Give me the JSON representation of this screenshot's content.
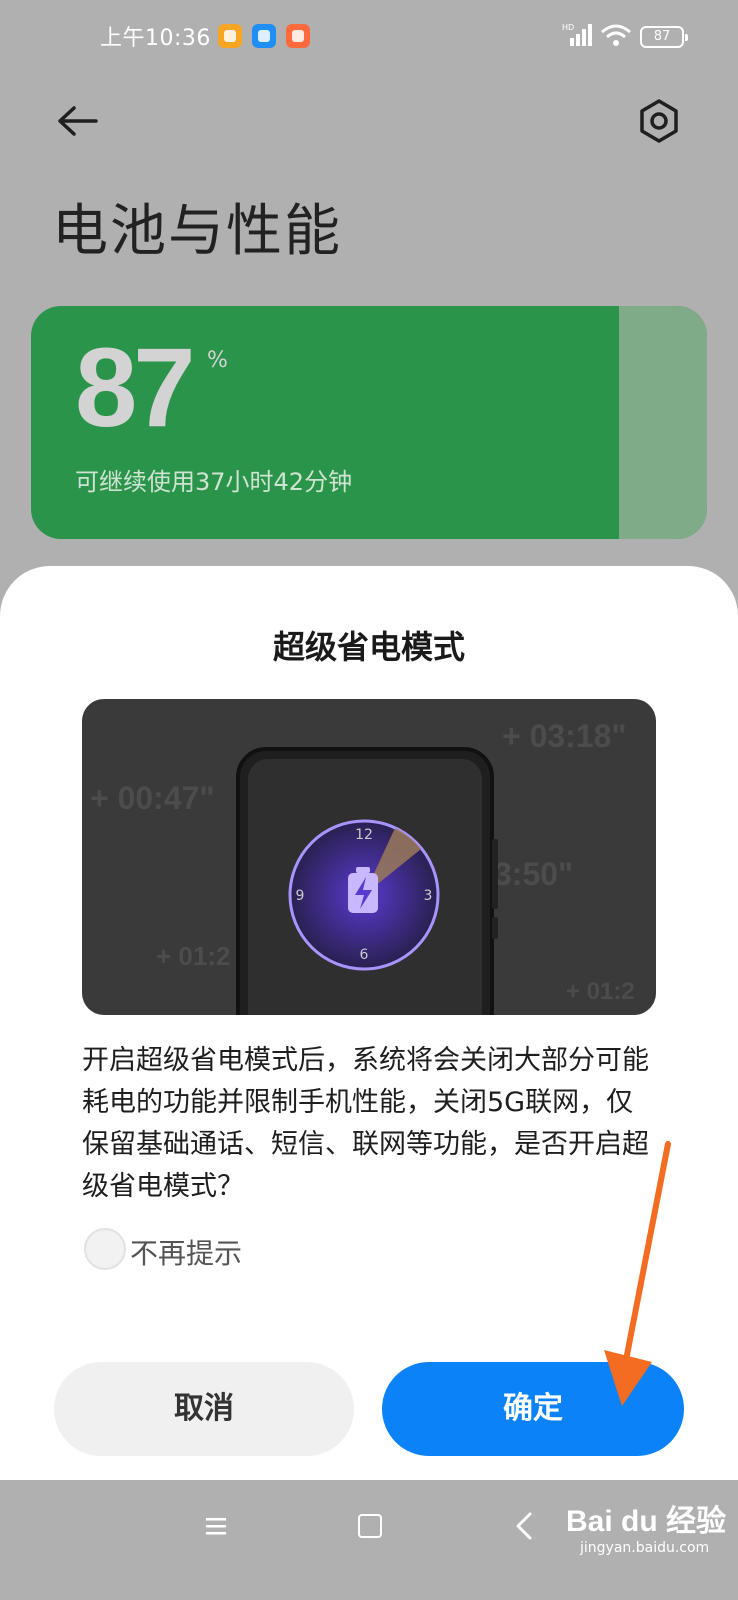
{
  "status_bar": {
    "time": "上午10:36",
    "battery_level": "87",
    "icons": [
      "notification-orange-icon",
      "notification-blue-icon",
      "notification-red-icon",
      "signal-hd-icon",
      "wifi-icon",
      "battery-icon"
    ]
  },
  "header": {
    "title": "电池与性能",
    "back_icon": "back-arrow-icon",
    "settings_icon": "settings-hexagon-icon"
  },
  "battery_card": {
    "percent": "87",
    "unit": "%",
    "remaining": "可继续使用37小时42分钟",
    "level_fraction": 0.87,
    "color": "#2a944a"
  },
  "dialog": {
    "title": "超级省电模式",
    "illustration": {
      "bg_times": [
        "+ 00:47\"",
        "+ 03:18\"",
        "3:50\"",
        "+ 01:2",
        "+ 01:2"
      ],
      "clock_numbers": [
        "12",
        "3",
        "6",
        "9"
      ]
    },
    "body": "开启超级省电模式后，系统将会关闭大部分可能耗电的功能并限制手机性能，关闭5G联网，仅保留基础通话、短信、联网等功能，是否开启超级省电模式？",
    "dont_remind_label": "不再提示",
    "cancel_label": "取消",
    "confirm_label": "确定",
    "confirm_color": "#0c82f8"
  },
  "nav_bar": {
    "icons": [
      "menu-icon",
      "home-icon",
      "back-icon"
    ],
    "watermark": "Bai du 经验",
    "watermark_url": "jingyan.baidu.com"
  }
}
